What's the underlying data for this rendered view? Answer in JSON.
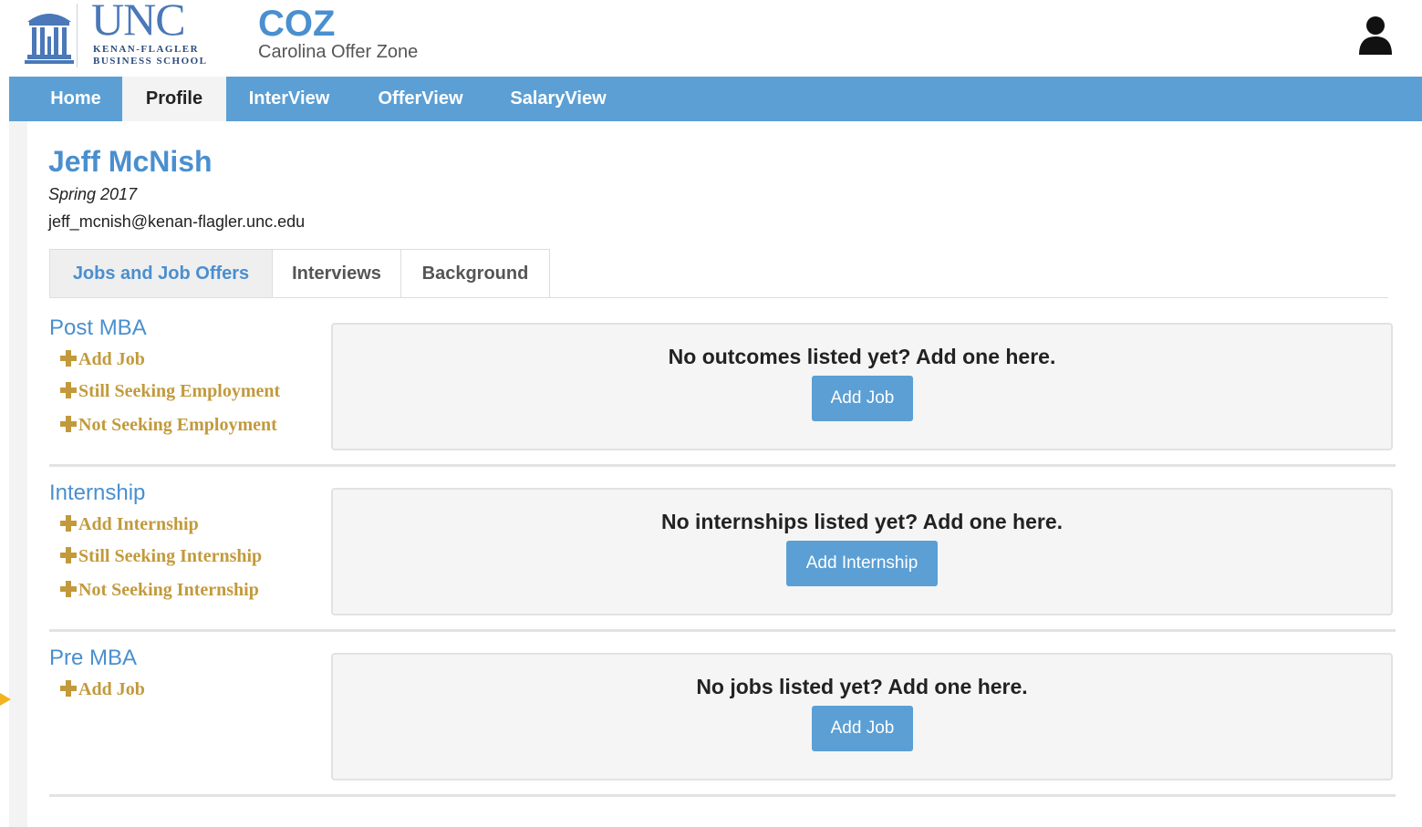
{
  "header": {
    "logo": {
      "wordmark": "UNC",
      "line1": "KENAN-FLAGLER",
      "line2": "BUSINESS SCHOOL",
      "icon": "old-well-icon"
    },
    "app_title": "COZ",
    "app_subtitle": "Carolina Offer Zone",
    "user_icon": "user-icon"
  },
  "nav": {
    "items": [
      {
        "label": "Home",
        "active": false
      },
      {
        "label": "Profile",
        "active": true
      },
      {
        "label": "InterView",
        "active": false
      },
      {
        "label": "OfferView",
        "active": false
      },
      {
        "label": "SalaryView",
        "active": false
      }
    ]
  },
  "profile": {
    "name": "Jeff McNish",
    "term": "Spring 2017",
    "email": "jeff_mcnish@kenan-flagler.unc.edu"
  },
  "tabs": [
    {
      "label": "Jobs and Job Offers",
      "active": true
    },
    {
      "label": "Interviews",
      "active": false
    },
    {
      "label": "Background",
      "active": false
    }
  ],
  "sections": [
    {
      "title": "Post MBA",
      "links": [
        "Add Job",
        "Still Seeking Employment",
        "Not Seeking Employment"
      ],
      "message": "No outcomes listed yet? Add one here.",
      "button": "Add Job"
    },
    {
      "title": "Internship",
      "links": [
        "Add Internship",
        "Still Seeking Internship",
        "Not Seeking Internship"
      ],
      "message": "No internships listed yet? Add one here.",
      "button": "Add Internship"
    },
    {
      "title": "Pre MBA",
      "links": [
        "Add Job"
      ],
      "message": "No jobs listed yet? Add one here.",
      "button": "Add Job"
    }
  ],
  "colors": {
    "brand_blue": "#5b9fd4",
    "title_blue": "#4a8fcf",
    "link_gold": "#c29a3c"
  }
}
